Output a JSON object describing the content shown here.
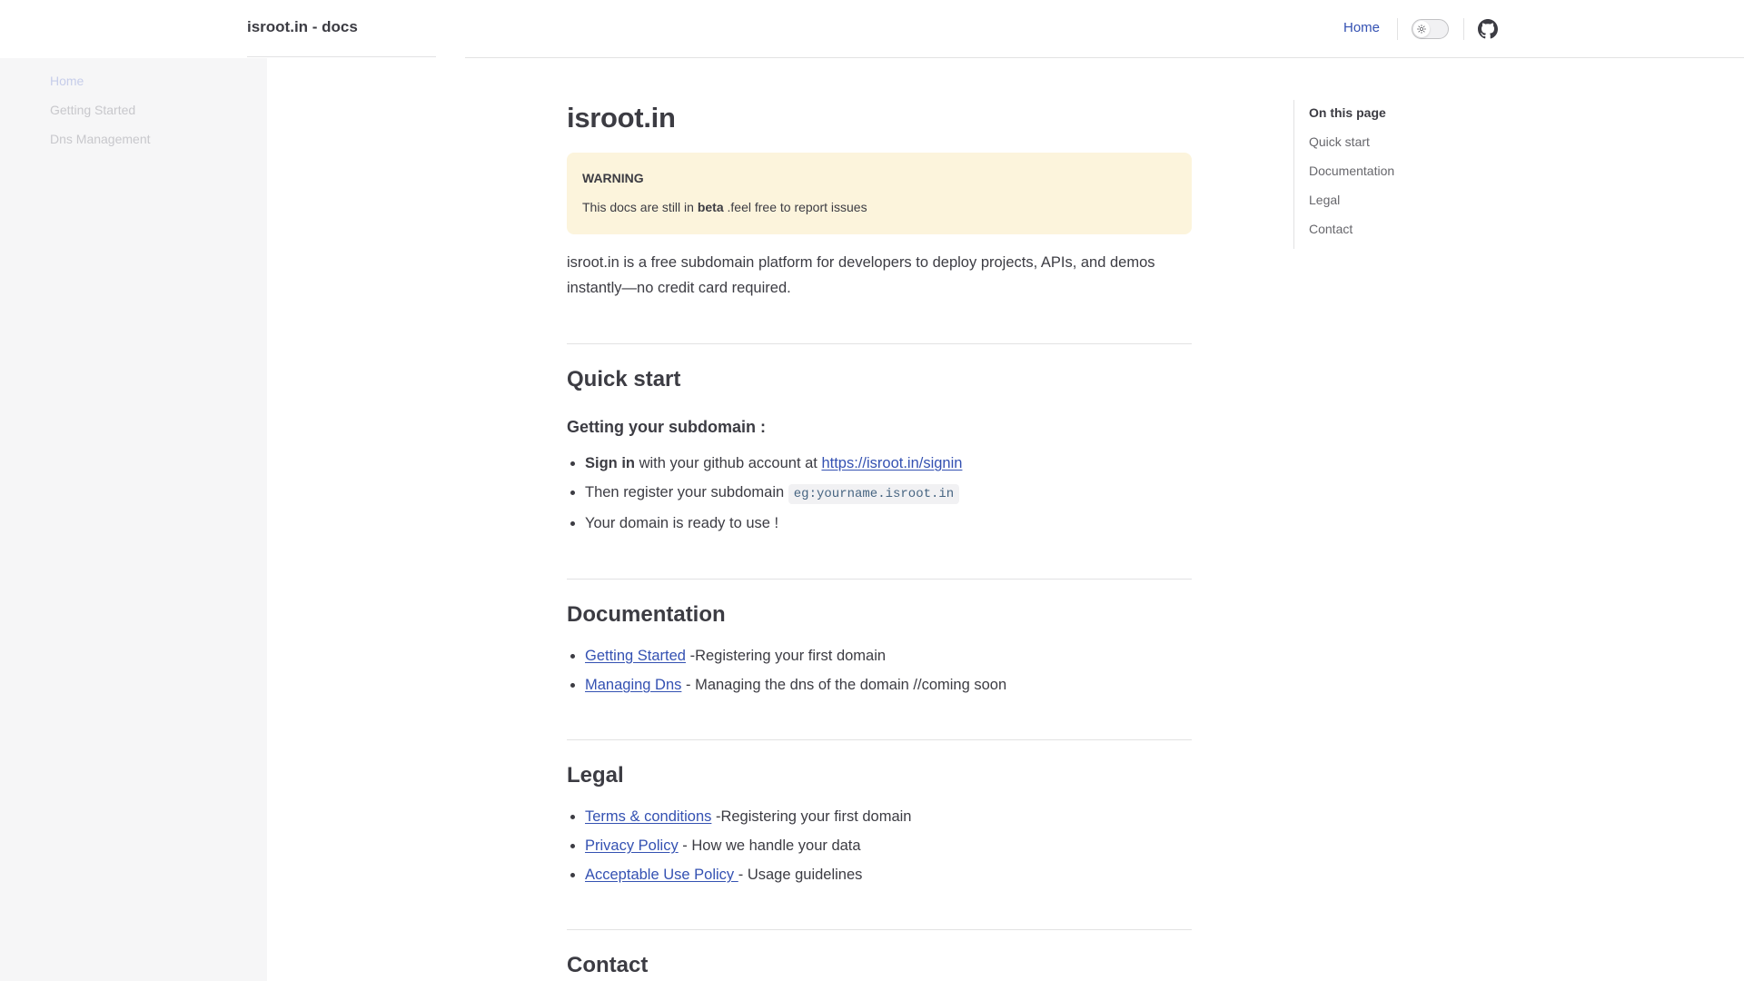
{
  "navbar": {
    "title": "isroot.in - docs",
    "home_link": "Home"
  },
  "sidebar": {
    "items": [
      {
        "label": "Home"
      },
      {
        "label": "Getting Started"
      },
      {
        "label": "Dns Management"
      }
    ]
  },
  "page": {
    "title": "isroot.in",
    "warning": {
      "title": "WARNING",
      "text_before": "This docs are still in ",
      "text_bold": "beta",
      "text_after": " .feel free to report issues"
    },
    "intro": "isroot.in is a free subdomain platform for developers to deploy projects, APIs, and demos instantly—no credit card required.",
    "quick_start": {
      "heading": "Quick start",
      "subheading": "Getting your subdomain :",
      "item1_bold": "Sign in",
      "item1_text": " with your github account at ",
      "item1_link": "https://isroot.in/signin",
      "item2_text": "Then register your subdomain ",
      "item2_code": "eg:yourname.isroot.in",
      "item3_text": "Your domain is ready to use !"
    },
    "documentation": {
      "heading": "Documentation",
      "item1_link": "Getting Started",
      "item1_text": " -Registering your first domain",
      "item2_link": "Managing Dns",
      "item2_text": " - Managing the dns of the domain //coming soon"
    },
    "legal": {
      "heading": "Legal",
      "item1_link": "Terms & conditions",
      "item1_text": " -Registering your first domain",
      "item2_link": "Privacy Policy",
      "item2_text": " - How we handle your data",
      "item3_link": "Acceptable Use Policy ",
      "item3_text": "- Usage guidelines"
    },
    "contact": {
      "heading": "Contact"
    }
  },
  "aside": {
    "title": "On this page",
    "items": [
      {
        "label": "Quick start"
      },
      {
        "label": "Documentation"
      },
      {
        "label": "Legal"
      },
      {
        "label": "Contact"
      }
    ]
  },
  "icons": {
    "theme_toggle": "sun-icon",
    "github": "github-icon"
  },
  "colors": {
    "brand": "#3451b2",
    "warning_bg": "#fcf4dc",
    "sidebar_bg": "#f6f6f7"
  }
}
